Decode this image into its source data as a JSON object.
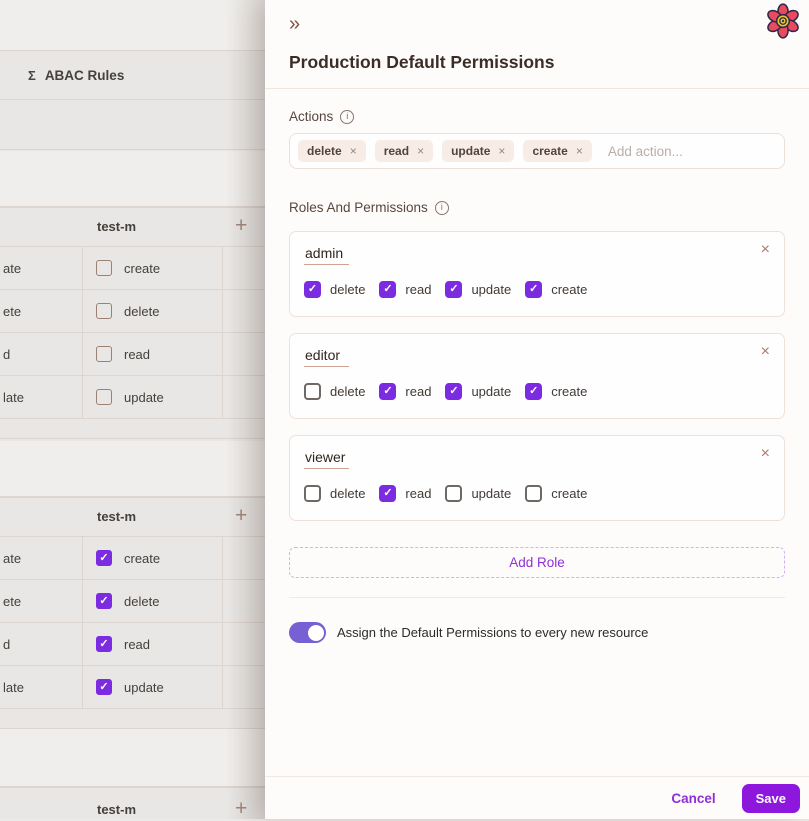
{
  "icons": {
    "collapse": "»",
    "plus": "+",
    "close": "×",
    "sigma": "Σ",
    "info": "i"
  },
  "colors": {
    "accent_purple": "#8d17dd",
    "checkbox_purple": "#7c2ce0",
    "toggle_purple": "#7760d4",
    "tag_background": "#f8ece7",
    "page_gray": "#e9e7e5"
  },
  "background": {
    "header": {
      "title": "ABAC Rules"
    },
    "tables": [
      {
        "title": "test-m",
        "rows": [
          {
            "cut_text": "ate",
            "label": "create",
            "checked": false
          },
          {
            "cut_text": "ete",
            "label": "delete",
            "checked": false
          },
          {
            "cut_text": "d",
            "label": "read",
            "checked": false
          },
          {
            "cut_text": "late",
            "label": "update",
            "checked": false
          }
        ]
      },
      {
        "title": "test-m",
        "rows": [
          {
            "cut_text": "ate",
            "label": "create",
            "checked": true
          },
          {
            "cut_text": "ete",
            "label": "delete",
            "checked": true
          },
          {
            "cut_text": "d",
            "label": "read",
            "checked": true
          },
          {
            "cut_text": "late",
            "label": "update",
            "checked": true
          }
        ]
      },
      {
        "title": "test-m",
        "rows": []
      }
    ]
  },
  "panel": {
    "title": "Production Default Permissions",
    "actions": {
      "label": "Actions",
      "tags": [
        "delete",
        "read",
        "update",
        "create"
      ],
      "placeholder": "Add action..."
    },
    "roles_section": {
      "label": "Roles And Permissions",
      "roles": [
        {
          "name": "admin",
          "permissions": [
            {
              "label": "delete",
              "checked": true
            },
            {
              "label": "read",
              "checked": true
            },
            {
              "label": "update",
              "checked": true
            },
            {
              "label": "create",
              "checked": true
            }
          ]
        },
        {
          "name": "editor",
          "permissions": [
            {
              "label": "delete",
              "checked": false
            },
            {
              "label": "read",
              "checked": true
            },
            {
              "label": "update",
              "checked": true
            },
            {
              "label": "create",
              "checked": true
            }
          ]
        },
        {
          "name": "viewer",
          "permissions": [
            {
              "label": "delete",
              "checked": false
            },
            {
              "label": "read",
              "checked": true
            },
            {
              "label": "update",
              "checked": false
            },
            {
              "label": "create",
              "checked": false
            }
          ]
        }
      ],
      "add_role_label": "Add Role"
    },
    "toggle": {
      "label": "Assign the Default Permissions to every new resource",
      "on": true
    },
    "footer": {
      "cancel_label": "Cancel",
      "save_label": "Save"
    }
  }
}
